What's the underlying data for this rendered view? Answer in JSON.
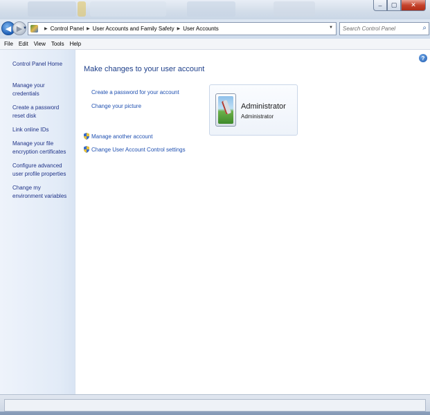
{
  "window": {
    "minimize_label": "–",
    "maximize_label": "▢",
    "close_label": "✕"
  },
  "address": {
    "crumbs": [
      "Control Panel",
      "User Accounts and Family Safety",
      "User Accounts"
    ],
    "search_placeholder": "Search Control Panel"
  },
  "menu": [
    "File",
    "Edit",
    "View",
    "Tools",
    "Help"
  ],
  "sidebar": {
    "home": "Control Panel Home",
    "items": [
      "Manage your credentials",
      "Create a password reset disk",
      "Link online IDs",
      "Manage your file encryption certificates",
      "Configure advanced user profile properties",
      "Change my environment variables"
    ]
  },
  "main": {
    "title": "Make changes to your user account",
    "links": [
      "Create a password for your account",
      "Change your picture"
    ],
    "shield_links": [
      "Manage another account",
      "Change User Account Control settings"
    ],
    "account": {
      "name": "Administrator",
      "type": "Administrator"
    }
  },
  "colors": {
    "link": "#1e4fb0",
    "title": "#1e3f8a",
    "sidebar_bg": "#e2ebf7"
  },
  "icons": {
    "back": "back-arrow-icon",
    "forward": "forward-arrow-icon",
    "help": "help-icon",
    "shield": "uac-shield-icon",
    "search": "search-icon"
  }
}
